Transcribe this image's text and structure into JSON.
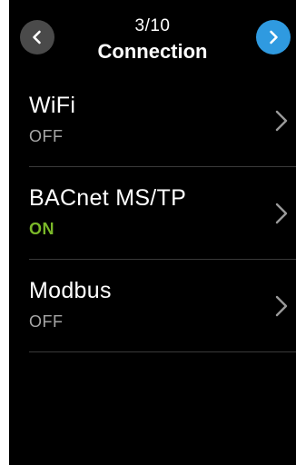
{
  "header": {
    "step": "3/10",
    "title": "Connection"
  },
  "icons": {
    "back": "chevron-left-icon",
    "next": "chevron-right-icon",
    "row_arrow": "chevron-right-icon"
  },
  "colors": {
    "background": "#000000",
    "back_button": "#4a4a4a",
    "next_button": "#2f9ae0",
    "status_off": "#a6a6a6",
    "status_on": "#7ab829",
    "divider": "#3a3a3a"
  },
  "items": [
    {
      "label": "WiFi",
      "status": "OFF"
    },
    {
      "label": "BACnet MS/TP",
      "status": "ON"
    },
    {
      "label": "Modbus",
      "status": "OFF"
    }
  ]
}
